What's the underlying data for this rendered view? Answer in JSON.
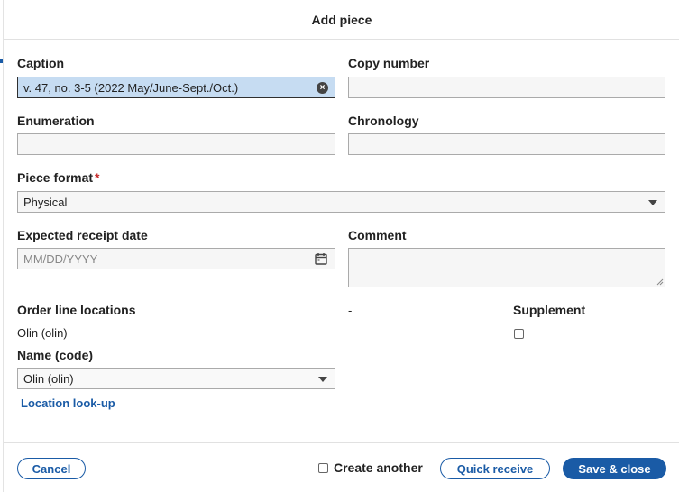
{
  "modal": {
    "title": "Add piece"
  },
  "form": {
    "caption": {
      "label": "Caption",
      "value": "v. 47, no. 3-5 (2022 May/June-Sept./Oct.)"
    },
    "copy_number": {
      "label": "Copy number",
      "value": ""
    },
    "enumeration": {
      "label": "Enumeration",
      "value": ""
    },
    "chronology": {
      "label": "Chronology",
      "value": ""
    },
    "piece_format": {
      "label": "Piece format",
      "required_mark": "*",
      "value": "Physical"
    },
    "expected_receipt_date": {
      "label": "Expected receipt date",
      "placeholder": "MM/DD/YYYY"
    },
    "comment": {
      "label": "Comment",
      "value": ""
    },
    "order_line_locations": {
      "label": "Order line locations",
      "value": "Olin (olin)",
      "dash": "-"
    },
    "supplement": {
      "label": "Supplement",
      "checked": false
    },
    "name_code": {
      "label": "Name (code)",
      "value": "Olin (olin)"
    },
    "location_lookup": "Location look-up"
  },
  "footer": {
    "cancel": "Cancel",
    "create_another": "Create another",
    "quick_receive": "Quick receive",
    "save_close": "Save & close"
  },
  "colors": {
    "accent": "#1a5ba6",
    "highlight": "#c6dcf2",
    "required": "#c62828"
  }
}
